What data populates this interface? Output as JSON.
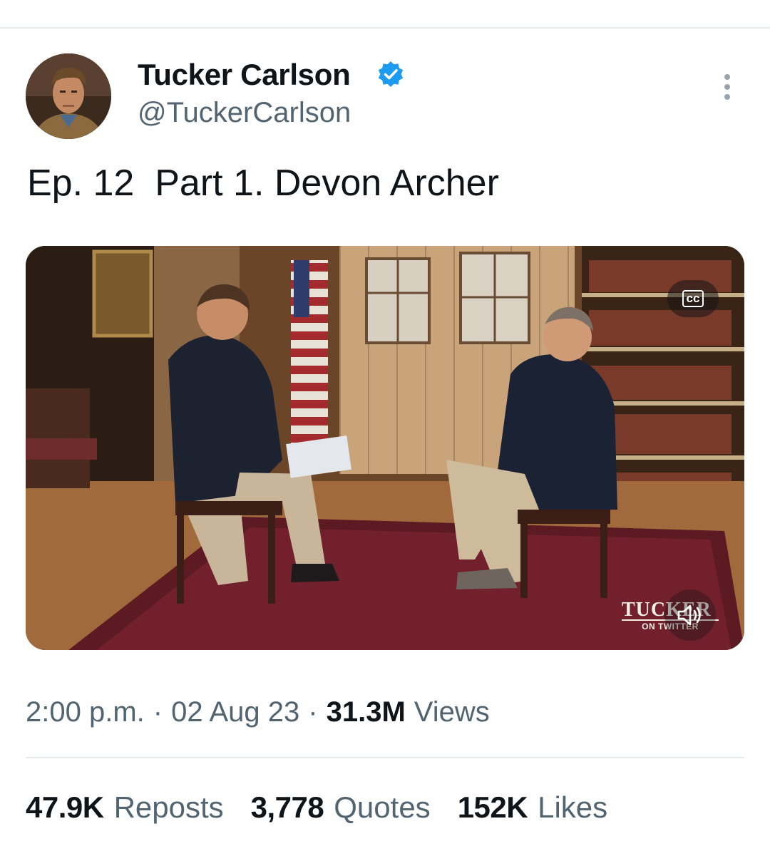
{
  "author": {
    "name": "Tucker Carlson",
    "handle": "@TuckerCarlson",
    "verified": true,
    "verified_color": "#1d9bf0"
  },
  "tweet": {
    "text": "Ep. 12  Part 1. Devon Archer"
  },
  "media": {
    "type": "video",
    "cc_label": "CC",
    "watermark_main": "TUCKER",
    "watermark_sub": "ON TWITTER",
    "icons": [
      "cc-icon",
      "volume-icon"
    ]
  },
  "meta": {
    "time": "2:00 p.m.",
    "separator": "·",
    "date": "02 Aug 23",
    "views_count": "31.3M",
    "views_label": "Views"
  },
  "stats": {
    "reposts_count": "47.9K",
    "reposts_label": "Reposts",
    "quotes_count": "3,778",
    "quotes_label": "Quotes",
    "likes_count": "152K",
    "likes_label": "Likes"
  },
  "colors": {
    "text_primary": "#0f1419",
    "text_secondary": "#536471",
    "divider": "#e6e9ec",
    "accent": "#1d9bf0"
  }
}
